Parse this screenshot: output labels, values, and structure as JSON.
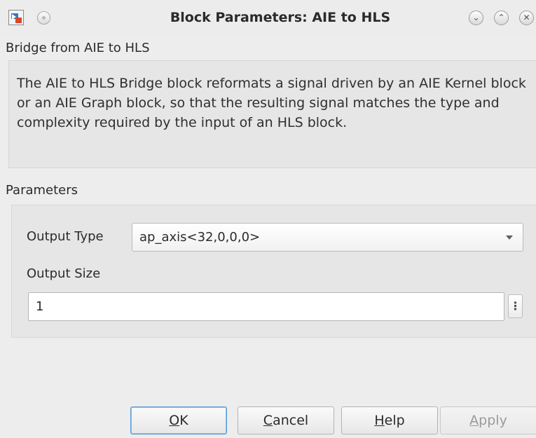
{
  "window": {
    "title": "Block Parameters: AIE to HLS",
    "icons": {
      "app": "simulink-block-icon",
      "menu": "window-menu-icon",
      "minimize": "minimize-icon",
      "maximize": "maximize-icon",
      "close": "close-icon"
    }
  },
  "header": {
    "subtitle": "Bridge from AIE to HLS",
    "description": "The AIE to HLS Bridge block reformats a signal driven by an AIE Kernel block or an AIE Graph block, so that the resulting signal matches the type and complexity required by the input of an HLS block."
  },
  "parameters": {
    "section_label": "Parameters",
    "output_type": {
      "label": "Output Type",
      "value": "ap_axis<32,0,0,0>"
    },
    "output_size": {
      "label": "Output Size",
      "value": "1"
    }
  },
  "buttons": {
    "ok": {
      "mnemonic": "O",
      "rest": "K"
    },
    "cancel": {
      "mnemonic": "C",
      "rest": "ancel"
    },
    "help": {
      "mnemonic": "H",
      "rest": "elp"
    },
    "apply": {
      "mnemonic": "A",
      "rest": "pply"
    }
  },
  "colors": {
    "window_bg": "#ededed",
    "panel_bg": "#e6e6e6",
    "default_button_border": "#5d9ad8",
    "disabled_text": "#9a9a9a"
  }
}
